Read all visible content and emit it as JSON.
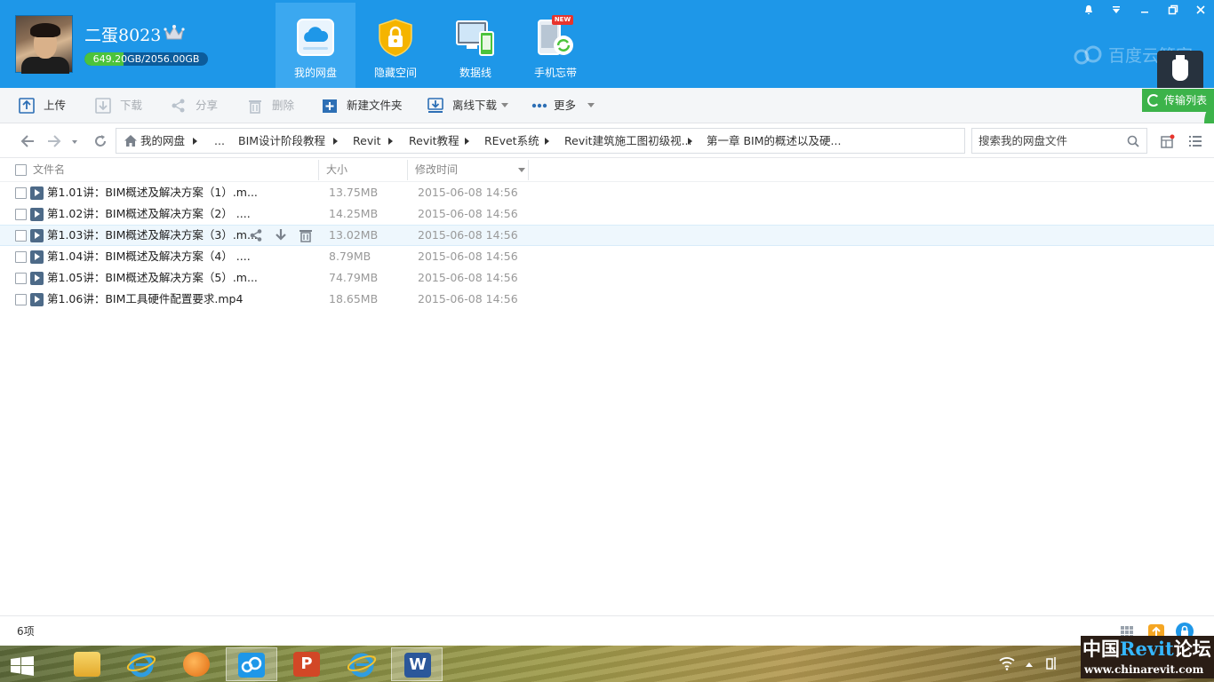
{
  "user": {
    "name": "二蛋8023",
    "quota_text": "649.20GB/2056.00GB",
    "quota_used_fraction": 0.316
  },
  "nav_tabs": [
    {
      "label": "我的网盘",
      "active": true
    },
    {
      "label": "隐藏空间",
      "active": false
    },
    {
      "label": "数据线",
      "active": false
    },
    {
      "label": "手机忘带",
      "active": false,
      "badge": "NEW"
    }
  ],
  "brand": "百度云管家",
  "toolbar": {
    "upload": "上传",
    "download": "下载",
    "share": "分享",
    "delete": "删除",
    "new_folder": "新建文件夹",
    "offline_download": "离线下载",
    "more": "更多",
    "transfer_list": "传输列表"
  },
  "breadcrumb": [
    "我的网盘",
    "...",
    "BIM设计阶段教程",
    "Revit",
    "Revit教程",
    "REvet系统",
    "Revit建筑施工图初级视...",
    "第一章 BIM的概述以及硬..."
  ],
  "search": {
    "placeholder": "搜索我的网盘文件"
  },
  "columns": {
    "name": "文件名",
    "size": "大小",
    "modified": "修改时间"
  },
  "files": [
    {
      "name": "第1.01讲：BIM概述及解决方案（1）.m...",
      "size": "13.75MB",
      "modified": "2015-06-08 14:56"
    },
    {
      "name": "第1.02讲：BIM概述及解决方案（2） ....",
      "size": "14.25MB",
      "modified": "2015-06-08 14:56"
    },
    {
      "name": "第1.03讲：BIM概述及解决方案（3）.m...",
      "size": "13.02MB",
      "modified": "2015-06-08 14:56"
    },
    {
      "name": "第1.04讲：BIM概述及解决方案（4） ....",
      "size": "8.79MB",
      "modified": "2015-06-08 14:56"
    },
    {
      "name": "第1.05讲：BIM概述及解决方案（5）.m...",
      "size": "74.79MB",
      "modified": "2015-06-08 14:56"
    },
    {
      "name": "第1.06讲：BIM工具硬件配置要求.mp4",
      "size": "18.65MB",
      "modified": "2015-06-08 14:56"
    }
  ],
  "status": {
    "count": "6项"
  },
  "watermark": {
    "line1_a": "中国",
    "line1_b": "Revit",
    "line1_c": "论坛",
    "line2": "www.chinarevit.com"
  },
  "colors": {
    "header": "#1e97e8",
    "active_tab": "#3ba8f0",
    "transfer_green": "#3cb34a",
    "quota_green": "#4cc33c"
  }
}
